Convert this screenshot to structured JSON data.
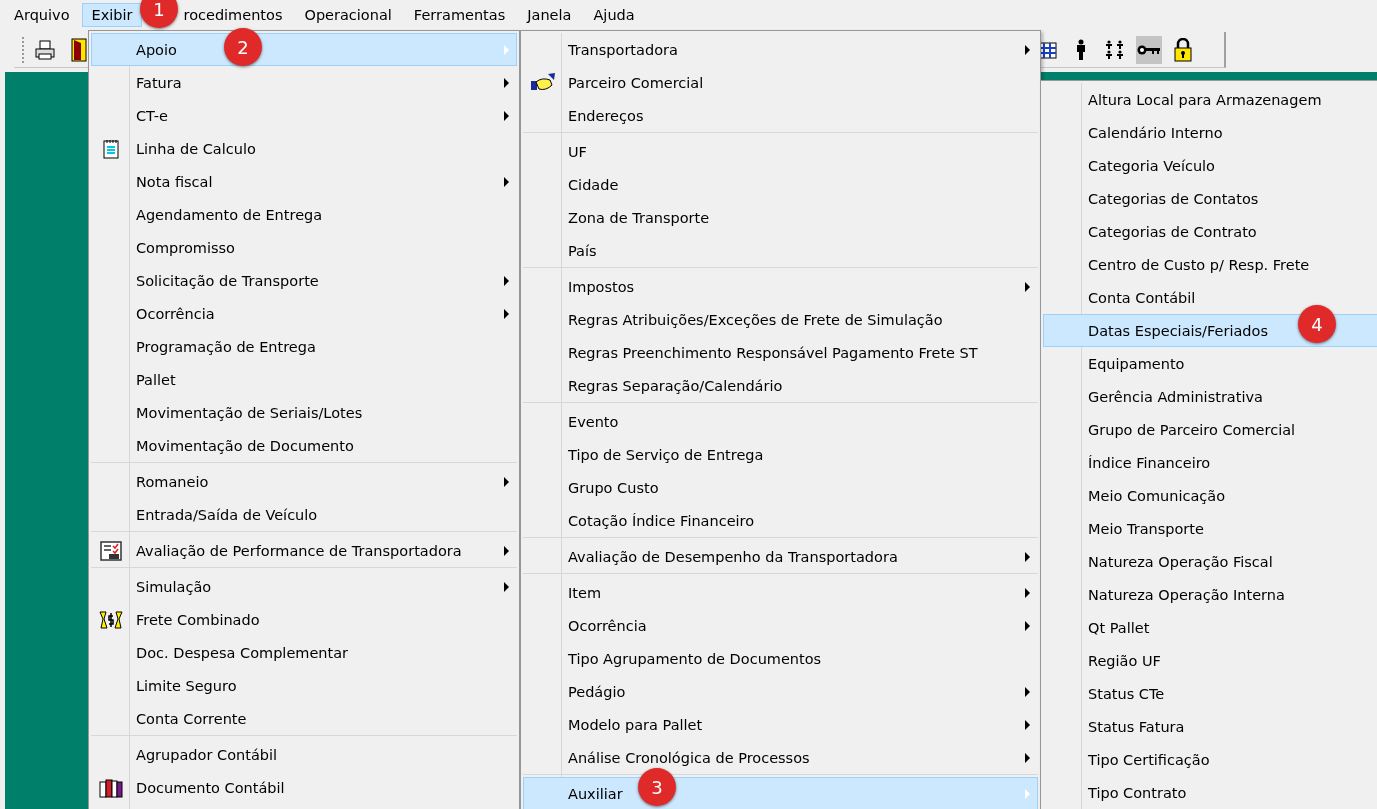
{
  "menubar": [
    {
      "label": "Arquivo",
      "selected": false
    },
    {
      "label": "Exibir",
      "selected": true
    },
    {
      "label": "rocedimentos",
      "selected": false
    },
    {
      "label": "Operacional",
      "selected": false
    },
    {
      "label": "Ferramentas",
      "selected": false
    },
    {
      "label": "Janela",
      "selected": false
    },
    {
      "label": "Ajuda",
      "selected": false
    }
  ],
  "toolbar": {
    "left": [
      {
        "kind": "printer",
        "pressed": false
      },
      {
        "kind": "door",
        "pressed": false
      }
    ],
    "right": [
      {
        "kind": "calendar",
        "pressed": false
      },
      {
        "kind": "person",
        "pressed": false
      },
      {
        "kind": "people",
        "pressed": false
      },
      {
        "kind": "key",
        "pressed": true
      },
      {
        "kind": "lock",
        "pressed": false
      }
    ]
  },
  "menus": [
    {
      "groups": [
        [
          {
            "label": "Apoio",
            "submenu": true,
            "selected": true
          },
          {
            "label": "Fatura",
            "submenu": true,
            "selected": false
          },
          {
            "label": "CT-e",
            "submenu": true,
            "selected": false
          },
          {
            "label": "Linha de Calculo",
            "submenu": false,
            "selected": false,
            "kind": "notepad"
          },
          {
            "label": "Nota fiscal",
            "submenu": true,
            "selected": false
          },
          {
            "label": "Agendamento de Entrega",
            "submenu": false,
            "selected": false
          },
          {
            "label": "Compromisso",
            "submenu": false,
            "selected": false
          },
          {
            "label": "Solicitação de Transporte",
            "submenu": true,
            "selected": false
          },
          {
            "label": "Ocorrência",
            "submenu": true,
            "selected": false
          },
          {
            "label": "Programação de Entrega",
            "submenu": false,
            "selected": false
          },
          {
            "label": "Pallet",
            "submenu": false,
            "selected": false
          },
          {
            "label": "Movimentação de Seriais/Lotes",
            "submenu": false,
            "selected": false
          },
          {
            "label": "Movimentação de Documento",
            "submenu": false,
            "selected": false
          }
        ],
        [
          {
            "label": "Romaneio",
            "submenu": true,
            "selected": false
          },
          {
            "label": "Entrada/Saída de Veículo",
            "submenu": false,
            "selected": false
          }
        ],
        [
          {
            "label": "Avaliação de Performance de Transportadora",
            "submenu": true,
            "selected": false,
            "kind": "checklist"
          }
        ],
        [
          {
            "label": "Simulação",
            "submenu": true,
            "selected": false
          },
          {
            "label": "Frete Combinado",
            "submenu": false,
            "selected": false,
            "kind": "money"
          },
          {
            "label": "Doc. Despesa Complementar",
            "submenu": false,
            "selected": false
          },
          {
            "label": "Limite Seguro",
            "submenu": false,
            "selected": false
          },
          {
            "label": "Conta Corrente",
            "submenu": false,
            "selected": false
          }
        ],
        [
          {
            "label": "Agrupador Contábil",
            "submenu": false,
            "selected": false
          },
          {
            "label": "Documento Contábil",
            "submenu": false,
            "selected": false,
            "kind": "books"
          }
        ]
      ]
    },
    {
      "groups": [
        [
          {
            "label": "Transportadora",
            "submenu": true,
            "selected": false
          },
          {
            "label": "Parceiro Comercial",
            "submenu": false,
            "selected": false,
            "kind": "handshake"
          },
          {
            "label": "Endereços",
            "submenu": false,
            "selected": false
          }
        ],
        [
          {
            "label": "UF",
            "submenu": false,
            "selected": false
          },
          {
            "label": "Cidade",
            "submenu": false,
            "selected": false
          },
          {
            "label": "Zona de Transporte",
            "submenu": false,
            "selected": false
          },
          {
            "label": "País",
            "submenu": false,
            "selected": false
          }
        ],
        [
          {
            "label": "Impostos",
            "submenu": true,
            "selected": false
          },
          {
            "label": "Regras Atribuições/Exceções de Frete de Simulação",
            "submenu": false,
            "selected": false
          },
          {
            "label": "Regras Preenchimento Responsável Pagamento Frete ST",
            "submenu": false,
            "selected": false
          },
          {
            "label": "Regras Separação/Calendário",
            "submenu": false,
            "selected": false
          }
        ],
        [
          {
            "label": "Evento",
            "submenu": false,
            "selected": false
          },
          {
            "label": "Tipo de Serviço de Entrega",
            "submenu": false,
            "selected": false
          },
          {
            "label": "Grupo Custo",
            "submenu": false,
            "selected": false
          },
          {
            "label": "Cotação Índice Financeiro",
            "submenu": false,
            "selected": false
          }
        ],
        [
          {
            "label": "Avaliação de Desempenho da Transportadora",
            "submenu": true,
            "selected": false
          }
        ],
        [
          {
            "label": "Item",
            "submenu": true,
            "selected": false
          },
          {
            "label": "Ocorrência",
            "submenu": true,
            "selected": false
          },
          {
            "label": "Tipo Agrupamento de Documentos",
            "submenu": false,
            "selected": false
          },
          {
            "label": "Pedágio",
            "submenu": true,
            "selected": false
          },
          {
            "label": "Modelo para Pallet",
            "submenu": true,
            "selected": false
          },
          {
            "label": "Análise Cronológica de Processos",
            "submenu": true,
            "selected": false
          }
        ],
        [
          {
            "label": "Auxiliar",
            "submenu": true,
            "selected": true
          }
        ]
      ]
    },
    {
      "groups": [
        [
          {
            "label": "Altura Local para Armazenagem",
            "submenu": false,
            "selected": false
          },
          {
            "label": "Calendário Interno",
            "submenu": false,
            "selected": false
          },
          {
            "label": "Categoria Veículo",
            "submenu": false,
            "selected": false
          },
          {
            "label": "Categorias de Contatos",
            "submenu": false,
            "selected": false
          },
          {
            "label": "Categorias de Contrato",
            "submenu": false,
            "selected": false
          },
          {
            "label": "Centro de Custo p/ Resp. Frete",
            "submenu": false,
            "selected": false
          },
          {
            "label": "Conta Contábil",
            "submenu": false,
            "selected": false
          },
          {
            "label": "Datas Especiais/Feriados",
            "submenu": false,
            "selected": true
          },
          {
            "label": "Equipamento",
            "submenu": false,
            "selected": false
          },
          {
            "label": "Gerência Administrativa",
            "submenu": false,
            "selected": false
          },
          {
            "label": "Grupo de Parceiro Comercial",
            "submenu": false,
            "selected": false
          },
          {
            "label": "Índice Financeiro",
            "submenu": false,
            "selected": false
          },
          {
            "label": "Meio Comunicação",
            "submenu": false,
            "selected": false
          },
          {
            "label": "Meio Transporte",
            "submenu": false,
            "selected": false
          },
          {
            "label": "Natureza Operação Fiscal",
            "submenu": false,
            "selected": false
          },
          {
            "label": "Natureza Operação Interna",
            "submenu": false,
            "selected": false
          },
          {
            "label": "Qt Pallet",
            "submenu": false,
            "selected": false
          },
          {
            "label": "Região UF",
            "submenu": false,
            "selected": false
          },
          {
            "label": "Status CTe",
            "submenu": false,
            "selected": false
          },
          {
            "label": "Status Fatura",
            "submenu": false,
            "selected": false
          },
          {
            "label": "Tipo Certificação",
            "submenu": false,
            "selected": false
          },
          {
            "label": "Tipo Contrato",
            "submenu": false,
            "selected": false
          }
        ]
      ]
    }
  ],
  "annotations": [
    {
      "label": "1"
    },
    {
      "label": "2"
    },
    {
      "label": "3"
    },
    {
      "label": "4"
    }
  ]
}
